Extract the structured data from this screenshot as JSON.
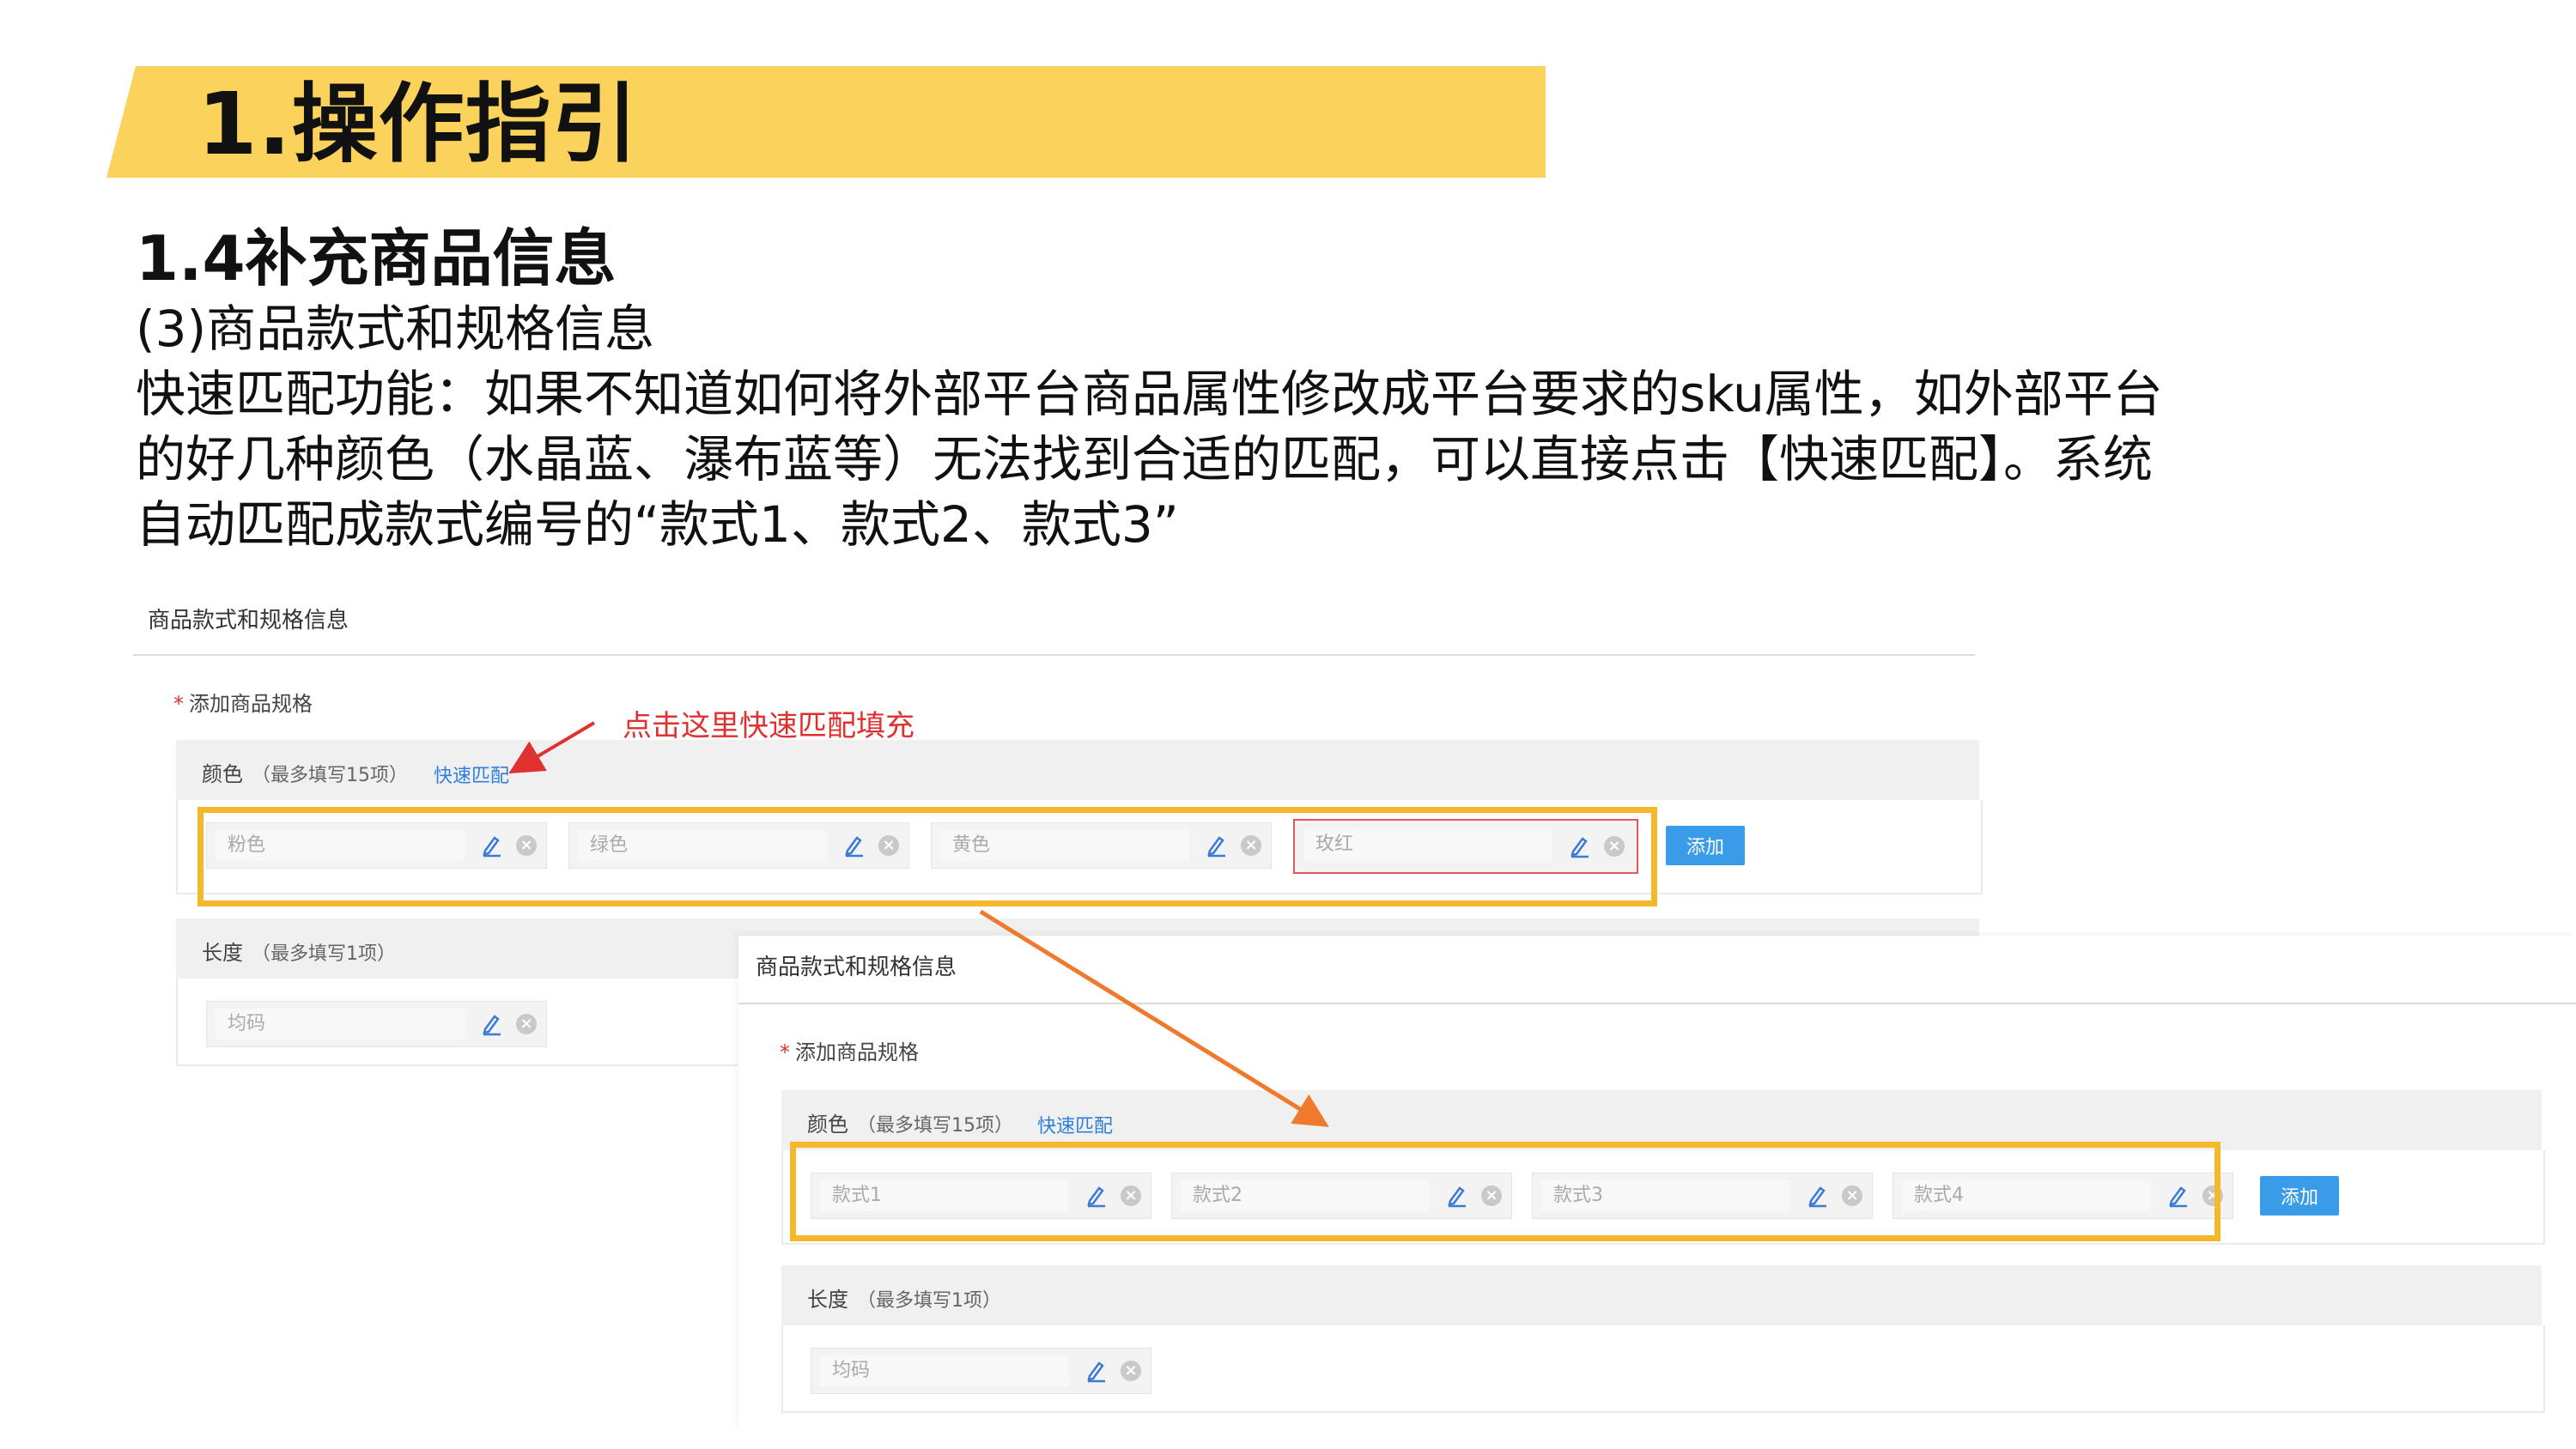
{
  "banner": {
    "title": "1.操作指引"
  },
  "section": {
    "heading": "1.4补充商品信息",
    "subheading": "(3)商品款式和规格信息",
    "paragraph_lines": [
      "快速匹配功能：如果不知道如何将外部平台商品属性修改成平台要求的sku属性，如外部平台",
      "的好几种颜色（水晶蓝、瀑布蓝等）无法找到合适的匹配，可以直接点击【快速匹配】。系统",
      "自动匹配成款式编号的“款式1、款式2、款式3”"
    ]
  },
  "screenshot_before": {
    "panel_title": "商品款式和规格信息",
    "required_label": "添加商品规格",
    "required_star": "*",
    "color_group": {
      "label": "颜色",
      "hint": "（最多填写15项）",
      "quick_match": "快速匹配"
    },
    "color_values": [
      "粉色",
      "绿色",
      "黄色",
      "玫红"
    ],
    "add_button": "添加",
    "length_group": {
      "label": "长度",
      "hint": "（最多填写1项）"
    },
    "length_values": [
      "均码"
    ]
  },
  "screenshot_after": {
    "panel_title": "商品款式和规格信息",
    "required_label": "添加商品规格",
    "required_star": "*",
    "color_group": {
      "label": "颜色",
      "hint": "（最多填写15项）",
      "quick_match": "快速匹配"
    },
    "color_values": [
      "款式1",
      "款式2",
      "款式3",
      "款式4"
    ],
    "add_button": "添加",
    "length_group": {
      "label": "长度",
      "hint": "（最多填写1项）"
    },
    "length_values": [
      "均码"
    ]
  },
  "annotation": {
    "text": "点击这里快速匹配填充"
  },
  "colors": {
    "banner": "#fbd25b",
    "highlight_box": "#f5b82a",
    "annotation_red": "#e03030",
    "link_blue": "#2f7fd8",
    "button_blue": "#3a9be8",
    "arrow_orange": "#f07a2c"
  }
}
